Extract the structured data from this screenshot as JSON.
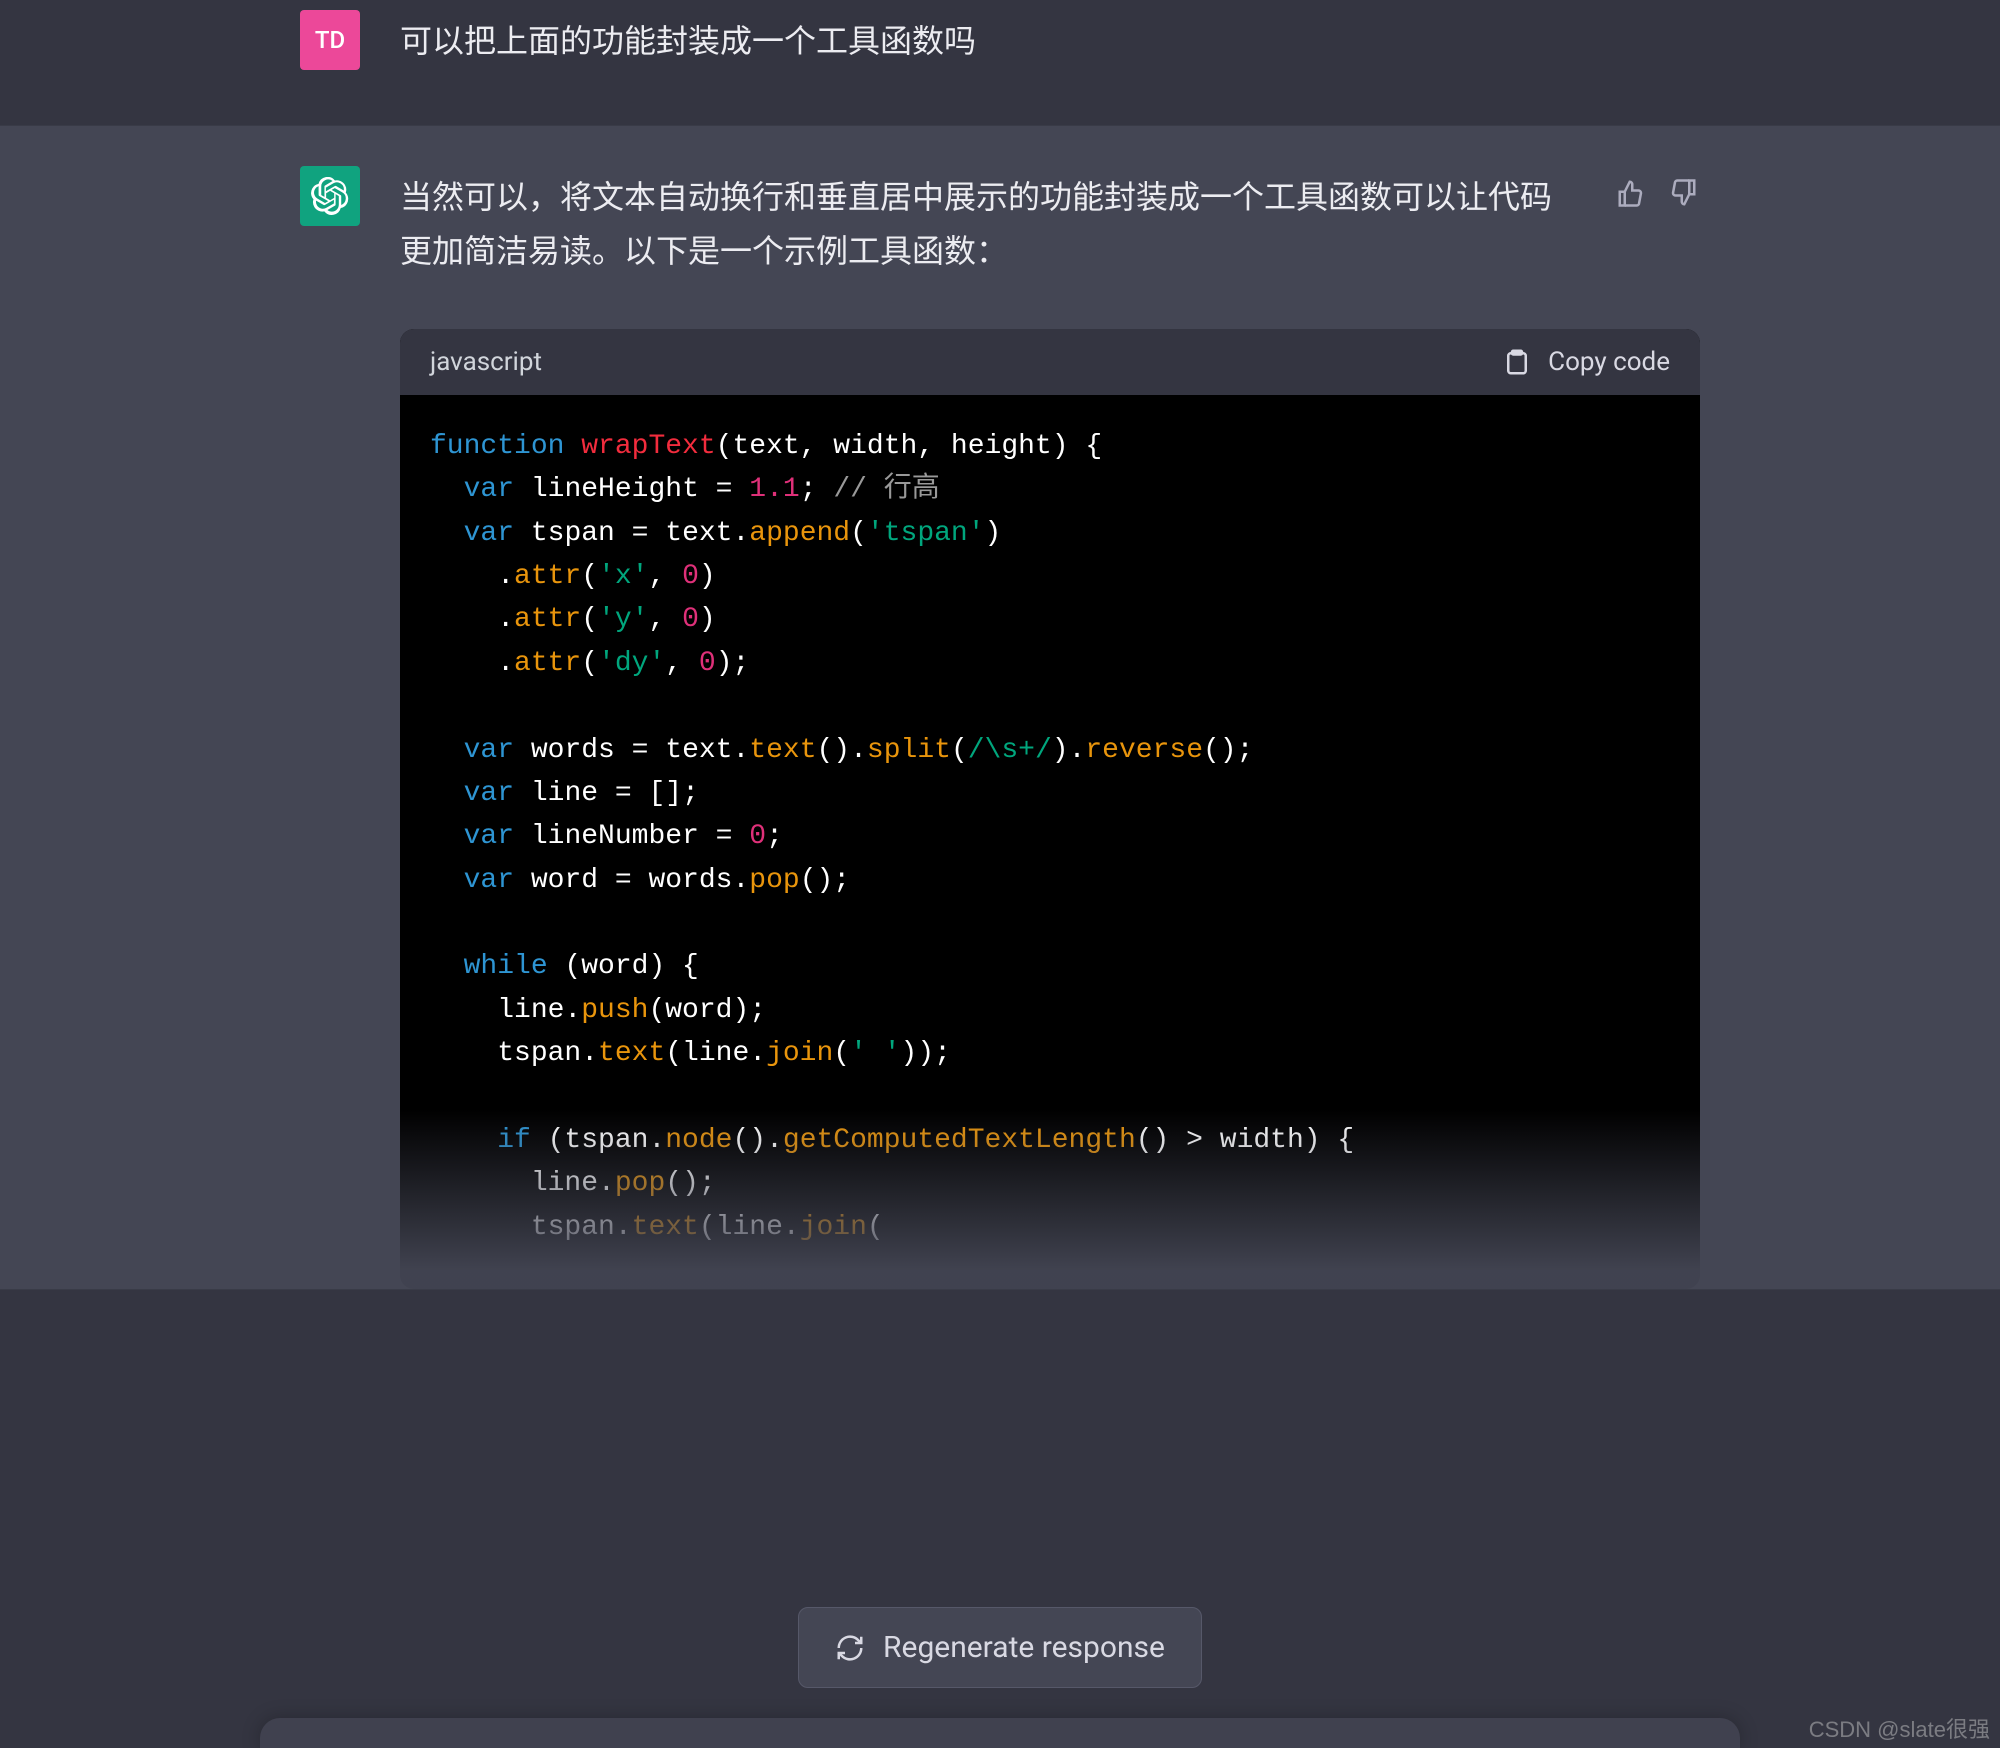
{
  "user": {
    "avatar_initials": "TD",
    "message": "可以把上面的功能封装成一个工具函数吗"
  },
  "assistant": {
    "intro": "当然可以，将文本自动换行和垂直居中展示的功能封装成一个工具函数可以让代码更加简洁易读。以下是一个示例工具函数：",
    "code": {
      "language": "javascript",
      "copy_label": "Copy code",
      "tokens": [
        [
          [
            "kw",
            "function"
          ],
          [
            "pn",
            " "
          ],
          [
            "fn",
            "wrapText"
          ],
          [
            "pn",
            "("
          ],
          [
            "id",
            "text, width, height"
          ],
          [
            "pn",
            ") {"
          ]
        ],
        [
          [
            "pn",
            "  "
          ],
          [
            "kw",
            "var"
          ],
          [
            "pn",
            " "
          ],
          [
            "id",
            "lineHeight = "
          ],
          [
            "num",
            "1.1"
          ],
          [
            "pn",
            "; "
          ],
          [
            "cm",
            "// 行高"
          ]
        ],
        [
          [
            "pn",
            "  "
          ],
          [
            "kw",
            "var"
          ],
          [
            "pn",
            " "
          ],
          [
            "id",
            "tspan = text."
          ],
          [
            "call",
            "append"
          ],
          [
            "pn",
            "("
          ],
          [
            "str",
            "'tspan'"
          ],
          [
            "pn",
            ")"
          ]
        ],
        [
          [
            "pn",
            "    ."
          ],
          [
            "call",
            "attr"
          ],
          [
            "pn",
            "("
          ],
          [
            "str",
            "'x'"
          ],
          [
            "pn",
            ", "
          ],
          [
            "num",
            "0"
          ],
          [
            "pn",
            ")"
          ]
        ],
        [
          [
            "pn",
            "    ."
          ],
          [
            "call",
            "attr"
          ],
          [
            "pn",
            "("
          ],
          [
            "str",
            "'y'"
          ],
          [
            "pn",
            ", "
          ],
          [
            "num",
            "0"
          ],
          [
            "pn",
            ")"
          ]
        ],
        [
          [
            "pn",
            "    ."
          ],
          [
            "call",
            "attr"
          ],
          [
            "pn",
            "("
          ],
          [
            "str",
            "'dy'"
          ],
          [
            "pn",
            ", "
          ],
          [
            "num",
            "0"
          ],
          [
            "pn",
            ");"
          ]
        ],
        [
          [
            "pn",
            ""
          ]
        ],
        [
          [
            "pn",
            "  "
          ],
          [
            "kw",
            "var"
          ],
          [
            "pn",
            " "
          ],
          [
            "id",
            "words = text."
          ],
          [
            "call",
            "text"
          ],
          [
            "pn",
            "()."
          ],
          [
            "call",
            "split"
          ],
          [
            "pn",
            "("
          ],
          [
            "re",
            "/\\s+/"
          ],
          [
            "pn",
            ")."
          ],
          [
            "call",
            "reverse"
          ],
          [
            "pn",
            "();"
          ]
        ],
        [
          [
            "pn",
            "  "
          ],
          [
            "kw",
            "var"
          ],
          [
            "pn",
            " "
          ],
          [
            "id",
            "line = [];"
          ]
        ],
        [
          [
            "pn",
            "  "
          ],
          [
            "kw",
            "var"
          ],
          [
            "pn",
            " "
          ],
          [
            "id",
            "lineNumber = "
          ],
          [
            "num",
            "0"
          ],
          [
            "pn",
            ";"
          ]
        ],
        [
          [
            "pn",
            "  "
          ],
          [
            "kw",
            "var"
          ],
          [
            "pn",
            " "
          ],
          [
            "id",
            "word = words."
          ],
          [
            "call",
            "pop"
          ],
          [
            "pn",
            "();"
          ]
        ],
        [
          [
            "pn",
            ""
          ]
        ],
        [
          [
            "pn",
            "  "
          ],
          [
            "kw",
            "while"
          ],
          [
            "pn",
            " (word) {"
          ]
        ],
        [
          [
            "pn",
            "    line."
          ],
          [
            "call",
            "push"
          ],
          [
            "pn",
            "(word);"
          ]
        ],
        [
          [
            "pn",
            "    tspan."
          ],
          [
            "call",
            "text"
          ],
          [
            "pn",
            "(line."
          ],
          [
            "call",
            "join"
          ],
          [
            "pn",
            "("
          ],
          [
            "str",
            "' '"
          ],
          [
            "pn",
            "));"
          ]
        ],
        [
          [
            "pn",
            ""
          ]
        ],
        [
          [
            "pn",
            "    "
          ],
          [
            "kw",
            "if"
          ],
          [
            "pn",
            " (tspan."
          ],
          [
            "call",
            "node"
          ],
          [
            "pn",
            "()."
          ],
          [
            "call",
            "getComputedTextLength"
          ],
          [
            "pn",
            "() > width) {"
          ]
        ],
        [
          [
            "pn",
            "      line."
          ],
          [
            "call",
            "pop"
          ],
          [
            "pn",
            "();"
          ]
        ],
        [
          [
            "pn",
            "      tspan."
          ],
          [
            "call",
            "text"
          ],
          [
            "pn",
            "(line."
          ],
          [
            "call",
            "join"
          ],
          [
            "pn",
            "("
          ]
        ]
      ]
    }
  },
  "feedback": {
    "thumbs_up_label": "thumbs-up",
    "thumbs_down_label": "thumbs-down"
  },
  "regenerate_label": "Regenerate response",
  "watermark": "CSDN @slate很强"
}
